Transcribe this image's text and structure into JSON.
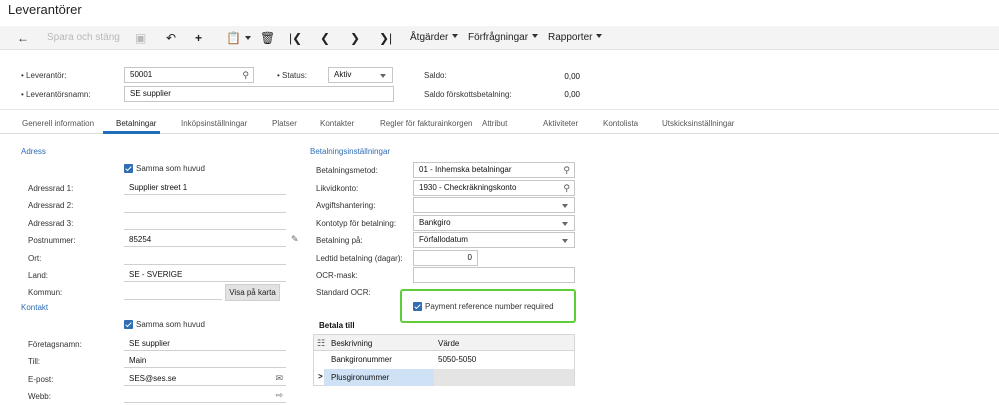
{
  "window": {
    "title": "Leverantörer"
  },
  "toolbar": {
    "back_icon": "arrow-left-icon",
    "save_close": "Spara och stäng",
    "save_icon": "floppy-icon",
    "undo_icon": "undo-icon",
    "add_icon": "plus-icon",
    "copy_icon": "clipboard-icon",
    "delete_icon": "trash-icon",
    "first_icon": "first-page-icon",
    "prev_icon": "chevron-left-icon",
    "next_icon": "chevron-right-icon",
    "last_icon": "last-page-icon",
    "actions": "Åtgärder",
    "inquiries": "Förfrågningar",
    "reports": "Rapporter"
  },
  "header": {
    "vendor_label": "Leverantör:",
    "vendor_value": "50001",
    "name_label": "Leverantörsnamn:",
    "name_value": "SE supplier",
    "status_label": "Status:",
    "status_value": "Aktiv",
    "balance_label": "Saldo:",
    "balance_value": "0,00",
    "prepay_label": "Saldo förskottsbetalning:",
    "prepay_value": "0,00"
  },
  "tabs": [
    "Generell information",
    "Betalningar",
    "Inköpsinställningar",
    "Platser",
    "Kontakter",
    "Regler för fakturainkorgen",
    "Attribut",
    "Aktiviteter",
    "Kontolista",
    "Utskicksinställningar"
  ],
  "address": {
    "section": "Adress",
    "same_as_main": "Samma som huvud",
    "addr1_label": "Adressrad 1:",
    "addr1_value": "Supplier street 1",
    "addr2_label": "Adressrad 2:",
    "addr3_label": "Adressrad 3:",
    "postal_label": "Postnummer:",
    "postal_value": "85254",
    "city_label": "Ort:",
    "country_label": "Land:",
    "country_value": "SE - SVERIGE",
    "municipality_label": "Kommun:",
    "map_button": "Visa på karta"
  },
  "contact": {
    "section": "Kontakt",
    "same_as_main": "Samma som huvud",
    "company_label": "Företagsnamn:",
    "company_value": "SE supplier",
    "attention_label": "Till:",
    "attention_value": "Main",
    "email_label": "E-post:",
    "email_value": "SES@ses.se",
    "web_label": "Webb:"
  },
  "payment": {
    "section": "Betalningsinställningar",
    "method_label": "Betalningsmetod:",
    "method_value": "01 - Inhemska betalningar",
    "cash_label": "Likvidkonto:",
    "cash_value": "1930 - Checkräkningskonto",
    "charge_label": "Avgiftshantering:",
    "account_type_label": "Kontotyp för betalning:",
    "account_type_value": "Bankgiro",
    "pay_on_label": "Betalning på:",
    "pay_on_value": "Förfallodatum",
    "lead_label": "Ledtid betalning (dagar):",
    "lead_value": "0",
    "ocr_mask_label": "OCR-mask:",
    "std_ocr_label": "Standard OCR:",
    "ref_required": "Payment reference number required"
  },
  "pay_to": {
    "title": "Betala till",
    "col_desc": "Beskrivning",
    "col_value": "Värde",
    "rows": [
      {
        "desc": "Bankgironummer",
        "value": "5050-5050"
      },
      {
        "desc": "Plusgironummer",
        "value": ""
      }
    ]
  }
}
